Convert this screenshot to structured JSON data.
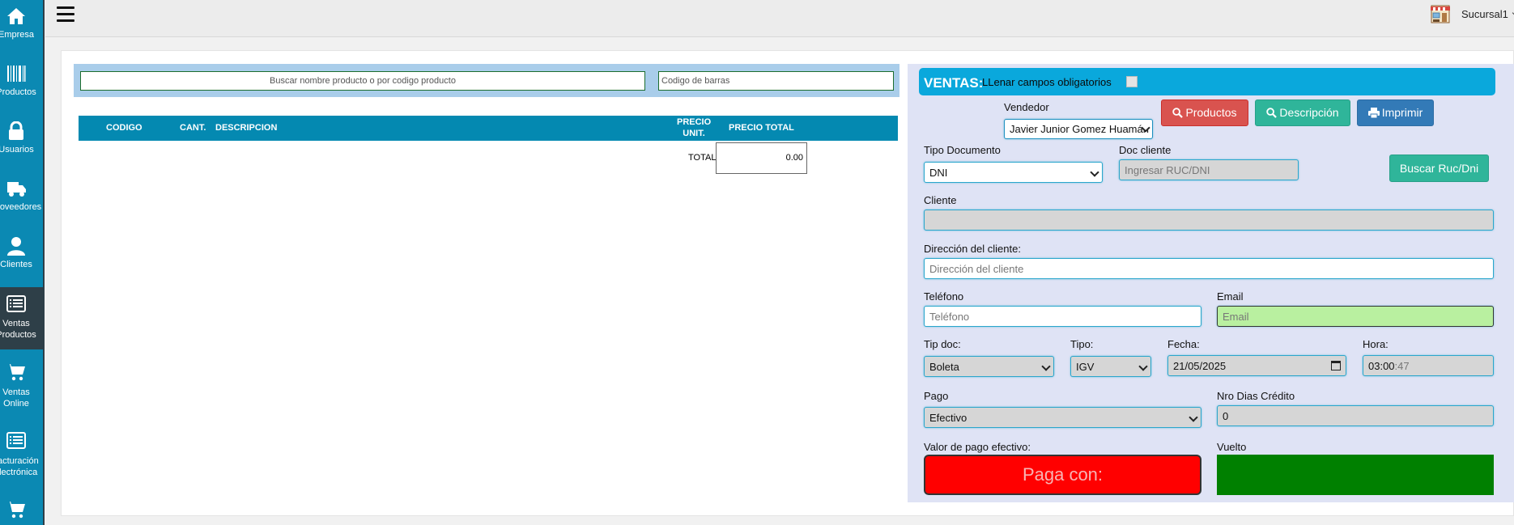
{
  "sidebar": {
    "items": [
      {
        "label": "Empresa",
        "icon": "home-icon"
      },
      {
        "label": "Productos",
        "icon": "barcode-icon"
      },
      {
        "label": "Usuarios",
        "icon": "lock-icon"
      },
      {
        "label": "Proveedores",
        "icon": "truck-icon"
      },
      {
        "label": "Clientes",
        "icon": "user-icon"
      },
      {
        "label": "Ventas Productos",
        "icon": "list-icon"
      },
      {
        "label": "Ventas Online",
        "icon": "cart-icon"
      },
      {
        "label": "Facturación Electrónica",
        "icon": "list-icon"
      },
      {
        "label": "",
        "icon": "cart-icon"
      }
    ],
    "active_index": 5
  },
  "topbar": {
    "branch": "Sucursal1"
  },
  "search": {
    "product_placeholder": "Buscar nombre producto o por codigo producto",
    "barcode_placeholder": "Codigo de barras"
  },
  "table": {
    "headers": {
      "codigo": "CODIGO",
      "cant": "CANT.",
      "descripcion": "DESCRIPCION",
      "precio_unit_1": "PRECIO",
      "precio_unit_2": "UNIT.",
      "precio_total": "PRECIO TOTAL"
    },
    "total_label": "TOTAL",
    "total_value": "0.00"
  },
  "form": {
    "title": "VENTAS:",
    "subtitle": "LLenar campos obligatorios",
    "vendedor_label": "Vendedor",
    "vendedor_value": "Javier Junior Gomez Huamán",
    "buttons": {
      "productos": "Productos",
      "descripcion": "Descripción",
      "imprimir": "Imprimir",
      "buscar_ruc": "Buscar Ruc/Dni"
    },
    "tipo_documento_label": "Tipo Documento",
    "tipo_documento_value": "DNI",
    "doc_cliente_label": "Doc cliente",
    "doc_cliente_placeholder": "Ingresar RUC/DNI",
    "cliente_label": "Cliente",
    "cliente_value": "",
    "direccion_label": "Dirección del cliente:",
    "direccion_placeholder": "Dirección del cliente",
    "telefono_label": "Teléfono",
    "telefono_placeholder": "Teléfono",
    "email_label": "Email",
    "email_placeholder": "Email",
    "tip_doc_label": "Tip doc:",
    "tip_doc_value": "Boleta",
    "tipo_label": "Tipo:",
    "tipo_value": "IGV",
    "fecha_label": "Fecha:",
    "fecha_value": "21/05/2025",
    "hora_label": "Hora:",
    "hora_value": "03:00",
    "hora_seconds": ":47",
    "pago_label": "Pago",
    "pago_value": "Efectivo",
    "nro_dias_label": "Nro Dias Crédito",
    "nro_dias_value": "0",
    "valor_pago_label": "Valor de pago efectivo:",
    "paga_con_placeholder": "Paga con:",
    "vuelto_label": "Vuelto"
  },
  "colors": {
    "sidebar": "#0b89b3",
    "header_bar": "#0aa8dc",
    "table_header": "#0489b1",
    "pay_box": "#ff0000",
    "change_box": "#008000"
  }
}
